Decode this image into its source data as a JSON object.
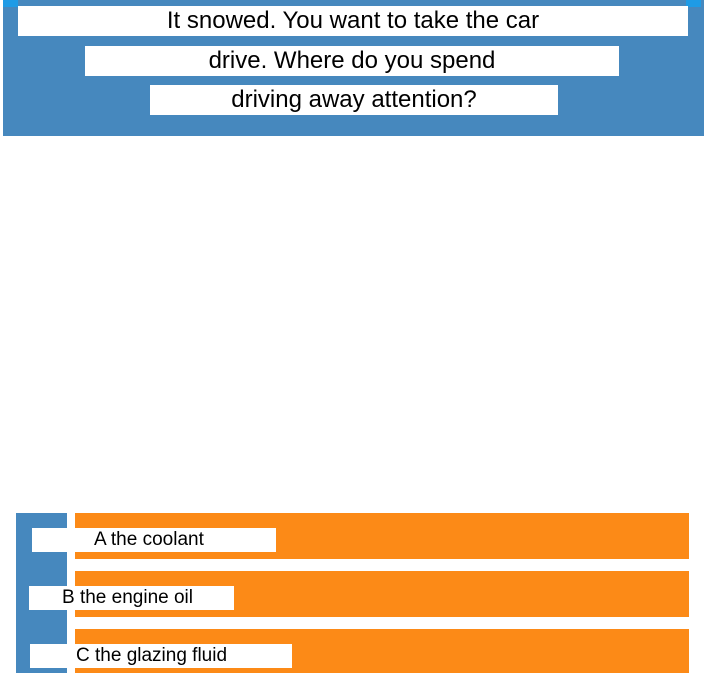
{
  "question": {
    "line1": "It snowed. You want to take the car",
    "line2": "drive. Where do you spend",
    "line3": "driving away attention?"
  },
  "options": [
    {
      "text": "A the coolant"
    },
    {
      "text": "B the engine oil"
    },
    {
      "text": "C the glazing fluid"
    }
  ],
  "colors": {
    "panel_blue": "#4688be",
    "accent_blue": "#1e9be6",
    "option_orange": "#fc8a17",
    "label_white": "#ffffff"
  }
}
